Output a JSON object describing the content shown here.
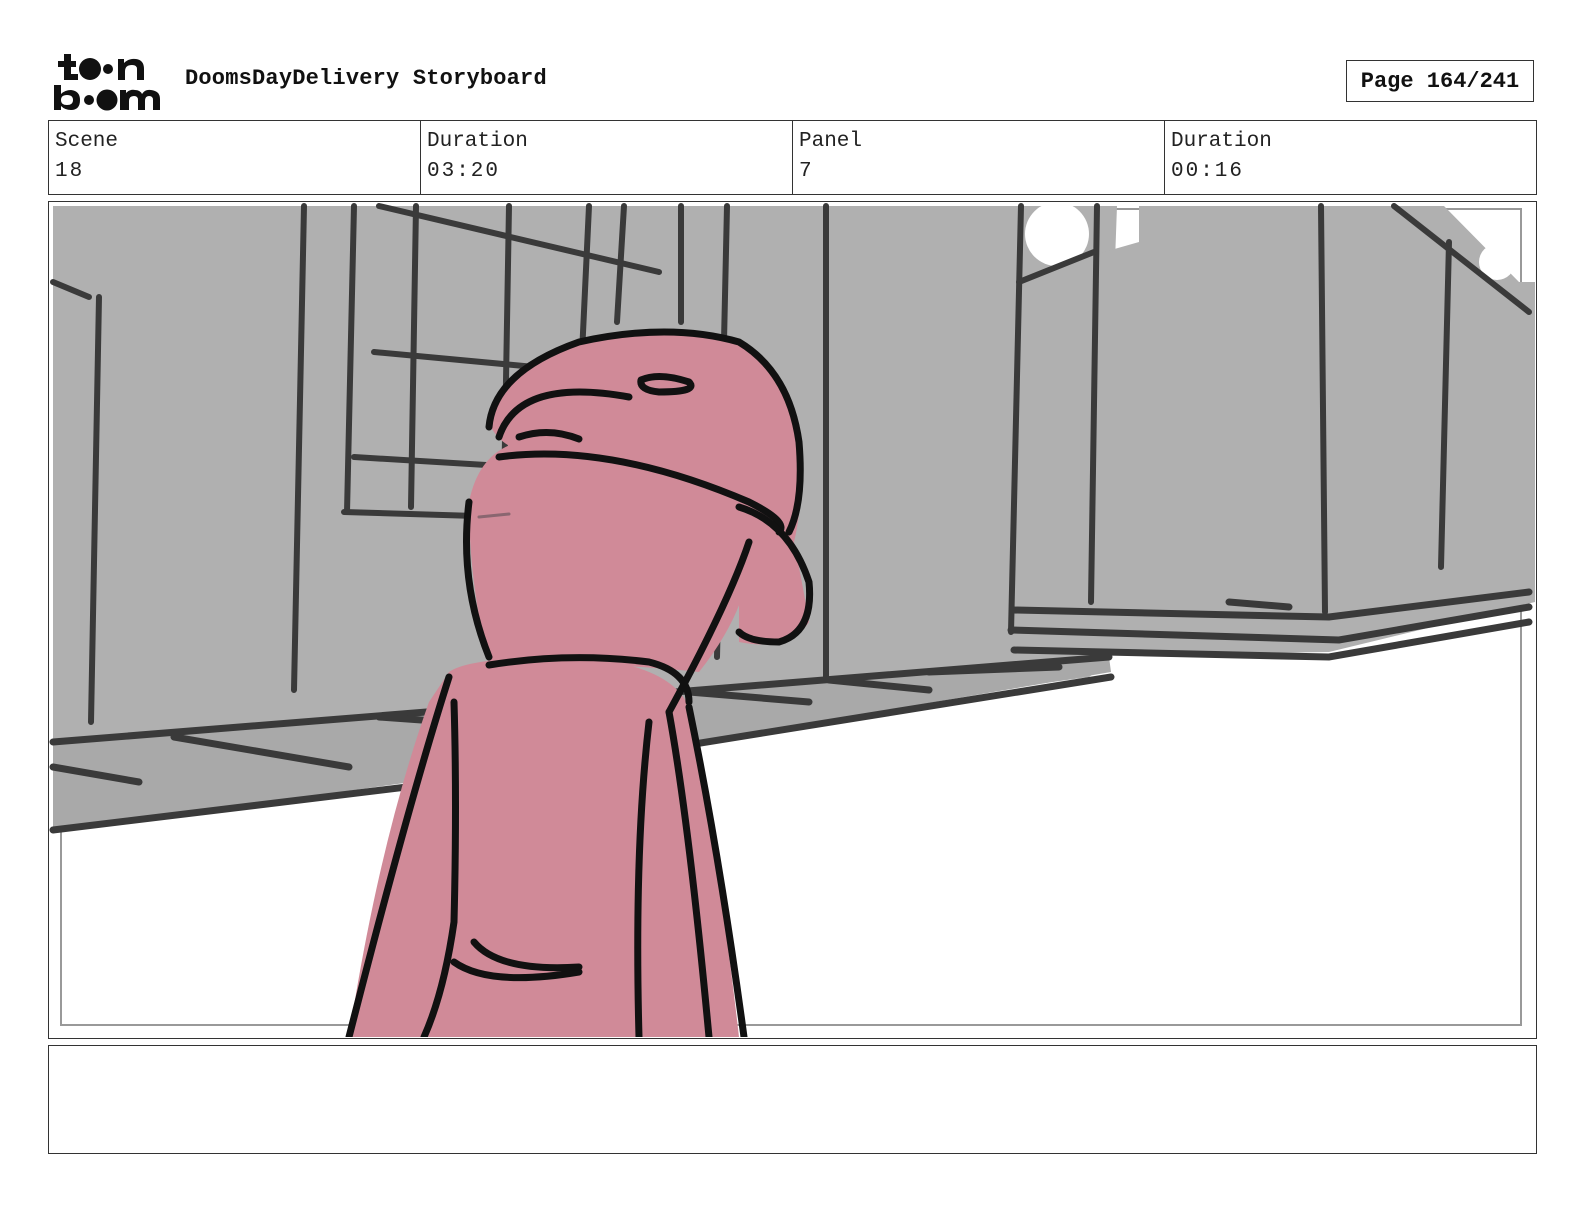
{
  "header": {
    "logo_text": "toon boom",
    "title": "DoomsDayDelivery Storyboard",
    "page_label": "Page 164/241"
  },
  "info": {
    "scene_label": "Scene",
    "scene_value": "18",
    "scene_duration_label": "Duration",
    "scene_duration_value": "03:20",
    "panel_label": "Panel",
    "panel_value": "7",
    "panel_duration_label": "Duration",
    "panel_duration_value": "00:16"
  },
  "colors": {
    "building_gray": "#b0b0b0",
    "character_pink": "#d08a98",
    "ink": "#111111",
    "frame_border": "#333333"
  },
  "notes": {
    "text": ""
  }
}
